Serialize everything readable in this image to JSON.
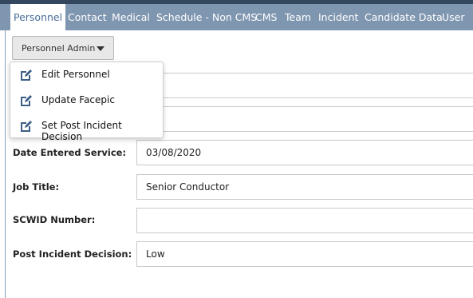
{
  "tabs": [
    {
      "label": "Personnel",
      "active": true
    },
    {
      "label": "Contact"
    },
    {
      "label": "Medical"
    },
    {
      "label": "Schedule - Non CMS"
    },
    {
      "label": "CMS"
    },
    {
      "label": "Team"
    },
    {
      "label": "Incident"
    },
    {
      "label": "Candidate Data"
    },
    {
      "label": "User"
    }
  ],
  "admin_button": {
    "label": "Personnel Admin",
    "icon": "caret-down-icon"
  },
  "admin_menu": {
    "items": [
      {
        "label": "Edit Personnel",
        "icon": "edit-icon"
      },
      {
        "label": "Update Facepic",
        "icon": "edit-icon"
      },
      {
        "label": "Set Post Incident Decision",
        "icon": "edit-icon"
      }
    ]
  },
  "form": {
    "fields": [
      {
        "label": "Date Entered Service:",
        "value": "03/08/2020"
      },
      {
        "label": "Job Title:",
        "value": "Senior Conductor"
      },
      {
        "label": "SCWID Number:",
        "value": ""
      },
      {
        "label": "Post Incident Decision:",
        "value": "Low"
      }
    ]
  },
  "colors": {
    "topbar": "#33475f",
    "tabbar": "#7f96b0",
    "active_tab_text": "#4a6f9a",
    "icon": "#3d5f86"
  }
}
